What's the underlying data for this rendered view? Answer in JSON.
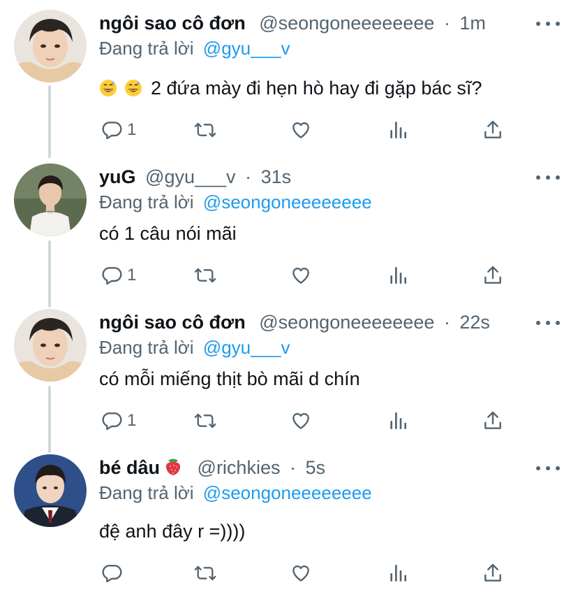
{
  "tweets": [
    {
      "display_name": "ngôi sao cô đơn",
      "handle": "@seongoneeeeeeee",
      "dot": "·",
      "time": "1m",
      "replying_prefix": "Đang trả lời",
      "replying_to": "@gyu___v",
      "emojis": [
        "grinning-sweat-emoji",
        "grinning-sweat-emoji"
      ],
      "text": "2 đứa mày đi hẹn hò hay đi gặp bác sĩ?",
      "reply_count": "1"
    },
    {
      "display_name": "yuG",
      "handle": "@gyu___v",
      "dot": "·",
      "time": "31s",
      "replying_prefix": "Đang trả lời",
      "replying_to": "@seongoneeeeeeee",
      "text": "có 1 câu nói mãi",
      "reply_count": "1"
    },
    {
      "display_name": "ngôi sao cô đơn",
      "handle": "@seongoneeeeeeee",
      "dot": "·",
      "time": "22s",
      "replying_prefix": "Đang trả lời",
      "replying_to": "@gyu___v",
      "text": "có mỗi miếng thịt bò mãi d chín",
      "reply_count": "1"
    },
    {
      "display_name": "bé dâu",
      "name_emoji": "strawberry-emoji",
      "handle": "@richkies",
      "dot": "·",
      "time": "5s",
      "replying_prefix": "Đang trả lời",
      "replying_to": "@seongoneeeeeeee",
      "text": "đệ anh đây r =))))",
      "reply_count": ""
    }
  ],
  "icons": {
    "reply": "reply-icon",
    "retweet": "retweet-icon",
    "like": "like-icon",
    "analytics": "analytics-icon",
    "share": "share-icon",
    "more": "more-icon"
  },
  "colors": {
    "text": "#0f1419",
    "secondary": "#536471",
    "link": "#1d9bf0",
    "thread_line": "#cfd9de"
  }
}
